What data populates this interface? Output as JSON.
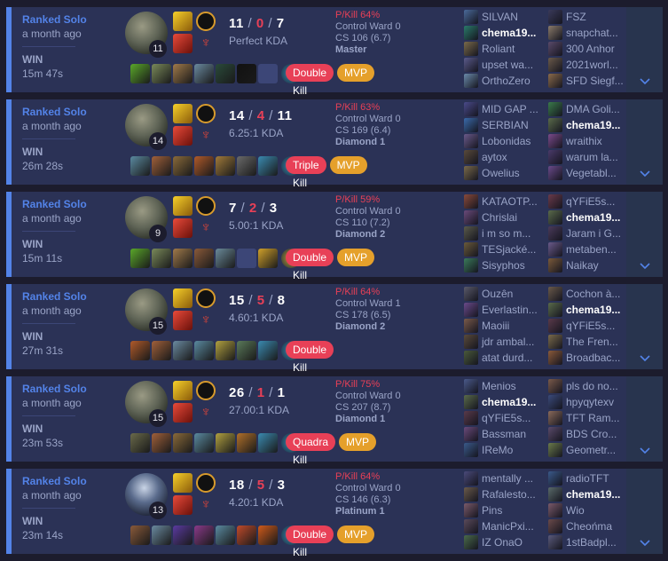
{
  "matches": [
    {
      "queue": "Ranked Solo",
      "ago": "a month ago",
      "result": "WIN",
      "duration": "15m 47s",
      "level": "11",
      "kills": "11",
      "deaths": "0",
      "assists": "7",
      "kda": "Perfect KDA",
      "pkill": "P/Kill 64%",
      "control_ward": "Control Ward 0",
      "cs": "CS 106 (6.7)",
      "tier": "Master",
      "multikill": "Double Kill",
      "mvp": "MVP",
      "items": [
        "#5aa82a",
        "#7a8a5a",
        "#a07a4a",
        "#6a8aa0",
        "#2a4a3a",
        "#111111",
        "empty"
      ],
      "ward_color": "#3a8ab0",
      "team1": [
        "SILVAN",
        "chema19...",
        "Roliant",
        "upset wa...",
        "OrthoZero"
      ],
      "team2": [
        "FSZ",
        "snapchat...",
        "300 Anhor",
        "2021worl...",
        "SFD Siegf..."
      ],
      "team1_icons": [
        "#4a6a9a",
        "#2a7a6a",
        "#7a6a4a",
        "#5a5a8a",
        "#6a8aaa"
      ],
      "team2_icons": [
        "#3a3a5a",
        "#8a7a6a",
        "#5a4a6a",
        "#6a5a4a",
        "#8a6a4a"
      ],
      "me_team": 1,
      "me_index": 1
    },
    {
      "queue": "Ranked Solo",
      "ago": "a month ago",
      "result": "WIN",
      "duration": "26m 28s",
      "level": "14",
      "kills": "14",
      "deaths": "4",
      "assists": "11",
      "kda": "6.25:1 KDA",
      "pkill": "P/Kill 63%",
      "control_ward": "Control Ward 0",
      "cs": "CS 169 (6.4)",
      "tier": "Diamond 1",
      "multikill": "Triple Kill",
      "mvp": "MVP",
      "items": [
        "#5a8aa0",
        "#a0603a",
        "#8a6a3a",
        "#b05a2a",
        "#a07a3a",
        "#6a6a6a",
        "#3a8ab0"
      ],
      "ward_color": "#3a8ab0",
      "team1": [
        "MID GAP ...",
        "SERBIAN",
        "Lobonidas",
        "aytox",
        "Owelius"
      ],
      "team2": [
        "DMA Goli...",
        "chema19...",
        "wraithix",
        "warum la...",
        "Vegetabl..."
      ],
      "team1_icons": [
        "#4a4a8a",
        "#3a6aaa",
        "#6a5a8a",
        "#5a4a3a",
        "#7a6a4a"
      ],
      "team2_icons": [
        "#3a7a4a",
        "#5a6a4a",
        "#7a4a8a",
        "#4a3a6a",
        "#6a4a8a"
      ],
      "me_team": 2,
      "me_index": 1
    },
    {
      "queue": "Ranked Solo",
      "ago": "a month ago",
      "result": "WIN",
      "duration": "15m 11s",
      "level": "9",
      "kills": "7",
      "deaths": "2",
      "assists": "3",
      "kda": "5.00:1 KDA",
      "pkill": "P/Kill 59%",
      "control_ward": "Control Ward 0",
      "cs": "CS 110 (7.2)",
      "tier": "Diamond 2",
      "multikill": "Double Kill",
      "mvp": "MVP",
      "items": [
        "#5aa82a",
        "#7a8a5a",
        "#a07a4a",
        "#8a5a3a",
        "#6a8a9a",
        "empty",
        "#d0a02a"
      ],
      "ward_color": "#c0a030",
      "team1": [
        "KATAOTP...",
        "Chrislai",
        "i m so m...",
        "TESjacké...",
        "Sisyphos"
      ],
      "team2": [
        "qYFiE5s...",
        "chema19...",
        "Jaram i G...",
        "metaben...",
        "Naikay"
      ],
      "team1_icons": [
        "#8a4a3a",
        "#6a4a7a",
        "#5a5a4a",
        "#6a5a3a",
        "#3a7a5a"
      ],
      "team2_icons": [
        "#6a3a4a",
        "#5a6a4a",
        "#4a3a5a",
        "#6a5a8a",
        "#7a5a3a"
      ],
      "me_team": 2,
      "me_index": 1
    },
    {
      "queue": "Ranked Solo",
      "ago": "a month ago",
      "result": "WIN",
      "duration": "27m 31s",
      "level": "15",
      "kills": "15",
      "deaths": "5",
      "assists": "8",
      "kda": "4.60:1 KDA",
      "pkill": "P/Kill 64%",
      "control_ward": "Control Ward 1",
      "cs": "CS 178 (6.5)",
      "tier": "Diamond 2",
      "multikill": "Double Kill",
      "mvp": "",
      "items": [
        "#b05a2a",
        "#a0603a",
        "#6a8aa0",
        "#5a8aa0",
        "#b0a040",
        "#5a7a5a",
        "#3a8ab0"
      ],
      "ward_color": "#3a8ab0",
      "team1": [
        "Ouzên",
        "Everlastin...",
        "Maoiii",
        "jdr ambal...",
        "atat durd..."
      ],
      "team2": [
        "Cochon à...",
        "chema19...",
        "qYFiE5s...",
        "The Fren...",
        "Broadbac..."
      ],
      "team1_icons": [
        "#5a5a6a",
        "#6a4a8a",
        "#7a5a4a",
        "#5a4a3a",
        "#4a5a3a"
      ],
      "team2_icons": [
        "#6a5a4a",
        "#5a6a4a",
        "#5a3a4a",
        "#7a6a4a",
        "#8a5a3a"
      ],
      "me_team": 2,
      "me_index": 1
    },
    {
      "queue": "Ranked Solo",
      "ago": "a month ago",
      "result": "WIN",
      "duration": "23m 53s",
      "level": "15",
      "kills": "26",
      "deaths": "1",
      "assists": "1",
      "kda": "27.00:1 KDA",
      "pkill": "P/Kill 75%",
      "control_ward": "Control Ward 0",
      "cs": "CS 207 (8.7)",
      "tier": "Diamond 1",
      "multikill": "Quadra Kill",
      "mvp": "MVP",
      "items": [
        "#6a6a4a",
        "#a0603a",
        "#8a6a3a",
        "#5a8aa0",
        "#b0a040",
        "#b0702a",
        "#3a8ab0"
      ],
      "ward_color": "#3a8ab0",
      "team1": [
        "Menios",
        "chema19...",
        "qYFiE5s...",
        "Bassman",
        "IReMo"
      ],
      "team2": [
        "pls do no...",
        "hpyqytexv",
        "TFT Ram...",
        "BDS Cro...",
        "Geometr..."
      ],
      "team1_icons": [
        "#4a5a8a",
        "#5a6a4a",
        "#5a3a4a",
        "#6a4a7a",
        "#3a5a8a"
      ],
      "team2_icons": [
        "#7a5a4a",
        "#3a4a7a",
        "#8a6a5a",
        "#5a4a6a",
        "#6a7a4a"
      ],
      "me_team": 1,
      "me_index": 1
    },
    {
      "queue": "Ranked Solo",
      "ago": "a month ago",
      "result": "WIN",
      "duration": "23m 14s",
      "level": "13",
      "kills": "18",
      "deaths": "5",
      "assists": "3",
      "kda": "4.20:1 KDA",
      "pkill": "P/Kill 64%",
      "control_ward": "Control Ward 0",
      "cs": "CS 146 (6.3)",
      "tier": "Platinum 1",
      "multikill": "Double Kill",
      "mvp": "MVP",
      "items": [
        "#8a5a3a",
        "#6a8aa0",
        "#5a3aa0",
        "#8a3a8a",
        "#5a8aa0",
        "#c04a2a",
        "#d05a1a"
      ],
      "ward_color": "#3a8ab0",
      "team1": [
        "mentally ...",
        "Rafalesto...",
        "Pins",
        "ManicPxi...",
        "IZ OnaO"
      ],
      "team2": [
        "radioTFT",
        "chema19...",
        "Wio",
        "Cheońma",
        "1stBadpl..."
      ],
      "team1_icons": [
        "#4a4a7a",
        "#6a5a4a",
        "#7a5a6a",
        "#5a4a5a",
        "#4a6a4a"
      ],
      "team2_icons": [
        "#3a5a8a",
        "#5a6a6a",
        "#7a5a6a",
        "#6a4a4a",
        "#5a5a7a"
      ],
      "me_team": 2,
      "me_index": 1
    }
  ]
}
